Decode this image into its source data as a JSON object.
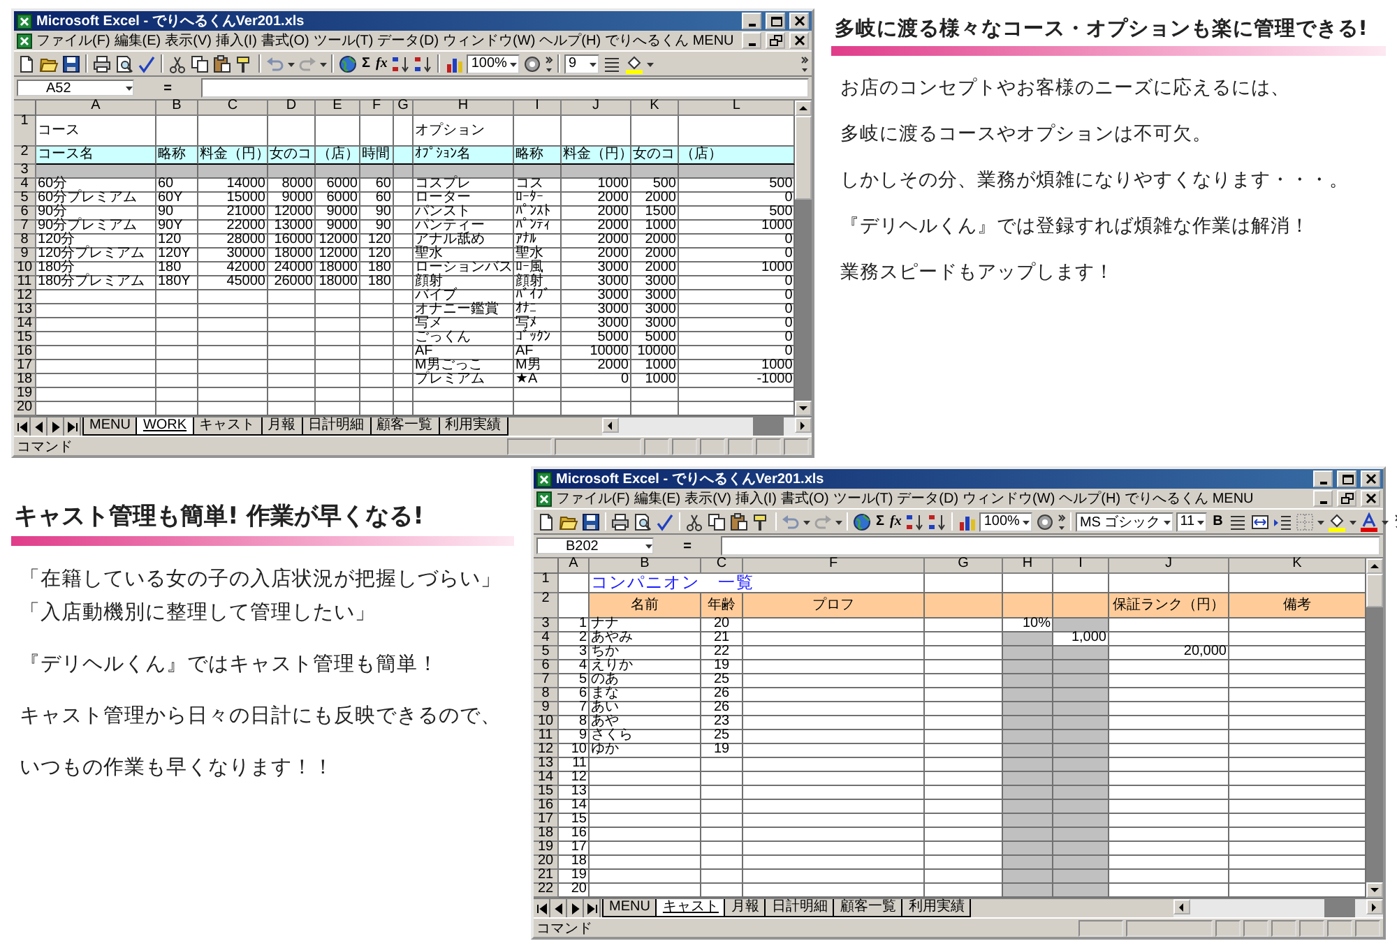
{
  "top": {
    "text": {
      "heading": "多岐に渡る様々なコース・オプションも楽に管理できる!",
      "lines": [
        "お店のコンセプトやお客様のニーズに応えるには、",
        "多岐に渡るコースやオプションは不可欠。",
        "しかしその分、業務が煩雑になりやすくなります・・・。",
        "『デリヘルくん』では登録すれば煩雑な作業は解消！",
        "業務スピードもアップします！"
      ]
    },
    "excel": {
      "kind": "course_sheet",
      "title": "Microsoft Excel - でりへるくんVer201.xls",
      "menu": [
        "ファイル(F)",
        "編集(E)",
        "表示(V)",
        "挿入(I)",
        "書式(O)",
        "ツール(T)",
        "データ(D)",
        "ウィンドウ(W)",
        "ヘルプ(H)",
        "でりへるくん MENU"
      ],
      "toolbar": {
        "sum": "Σ",
        "function": "fx",
        "zoom": "100%",
        "font_size": "9"
      },
      "name_box": "A52",
      "formula_sign": "=",
      "columns": [
        "A",
        "B",
        "C",
        "D",
        "E",
        "F",
        "G",
        "H",
        "I",
        "J",
        "K",
        "L"
      ],
      "row_numbers": [
        "1",
        "2",
        "3",
        "4",
        "5",
        "6",
        "7",
        "8",
        "9",
        "10",
        "11",
        "12",
        "13",
        "14",
        "15",
        "16",
        "17",
        "18",
        "19",
        "20"
      ],
      "course": {
        "title": "コース",
        "headers": [
          "コース名",
          "略称",
          "料金（円）",
          "女のコ",
          "（店）",
          "時間"
        ],
        "rows": [
          [
            "60分",
            "60",
            "14000",
            "8000",
            "6000",
            "60"
          ],
          [
            "60分プレミアム",
            "60Y",
            "15000",
            "9000",
            "6000",
            "60"
          ],
          [
            "90分",
            "90",
            "21000",
            "12000",
            "9000",
            "90"
          ],
          [
            "90分プレミアム",
            "90Y",
            "22000",
            "13000",
            "9000",
            "90"
          ],
          [
            "120分",
            "120",
            "28000",
            "16000",
            "12000",
            "120"
          ],
          [
            "120分プレミアム",
            "120Y",
            "30000",
            "18000",
            "12000",
            "120"
          ],
          [
            "180分",
            "180",
            "42000",
            "24000",
            "18000",
            "180"
          ],
          [
            "180分プレミアム",
            "180Y",
            "45000",
            "26000",
            "18000",
            "180"
          ]
        ]
      },
      "options": {
        "title": "オプション",
        "headers": [
          "ｵﾌﾟｼｮﾝ名",
          "略称",
          "料金（円）",
          "女のコ",
          "（店）"
        ],
        "rows": [
          [
            "コスプレ",
            "コス",
            "1000",
            "500",
            "500"
          ],
          [
            "ローター",
            "ﾛｰﾀｰ",
            "2000",
            "2000",
            "0"
          ],
          [
            "パンスト",
            "ﾊﾟﾝｽﾄ",
            "2000",
            "1500",
            "500"
          ],
          [
            "パンティー",
            "ﾊﾟﾝﾃｨ",
            "2000",
            "1000",
            "1000"
          ],
          [
            "アナル舐め",
            "ｱﾅﾙ",
            "2000",
            "2000",
            "0"
          ],
          [
            "聖水",
            "聖水",
            "2000",
            "2000",
            "0"
          ],
          [
            "ローションバス",
            "ﾛｰ風",
            "3000",
            "2000",
            "1000"
          ],
          [
            "顔射",
            "顔射",
            "3000",
            "3000",
            "0"
          ],
          [
            "バイブ",
            "ﾊﾞｲﾌﾞ",
            "3000",
            "3000",
            "0"
          ],
          [
            "オナニー鑑賞",
            "ｵﾅﾆ",
            "3000",
            "3000",
            "0"
          ],
          [
            "写メ",
            "写ﾒ",
            "3000",
            "3000",
            "0"
          ],
          [
            "ごっくん",
            "ｺﾞｯｸﾝ",
            "5000",
            "5000",
            "0"
          ],
          [
            "AF",
            "AF",
            "10000",
            "10000",
            "0"
          ],
          [
            "M男ごっこ",
            "M男",
            "2000",
            "1000",
            "1000"
          ],
          [
            "プレミアム",
            "★A",
            "0",
            "1000",
            "-1000"
          ]
        ]
      },
      "sheet_tabs": [
        {
          "label": "MENU",
          "selected": false
        },
        {
          "label": "WORK",
          "selected": true
        },
        {
          "label": "キャスト",
          "selected": false
        },
        {
          "label": "月報",
          "selected": false
        },
        {
          "label": "日計明細",
          "selected": false
        },
        {
          "label": "顧客一覧",
          "selected": false
        },
        {
          "label": "利用実績",
          "selected": false
        }
      ],
      "status": "コマンド"
    }
  },
  "bottom": {
    "text": {
      "heading": "キャスト管理も簡単! 作業が早くなる!",
      "lines": [
        "「在籍している女の子の入店状況が把握しづらい」",
        "「入店動機別に整理して管理したい」",
        "『デリヘルくん』ではキャスト管理も簡単！",
        "キャスト管理から日々の日計にも反映できるので、",
        "いつもの作業も早くなります！！"
      ]
    },
    "excel": {
      "kind": "cast_sheet",
      "title": "Microsoft Excel - でりへるくんVer201.xls",
      "menu": [
        "ファイル(F)",
        "編集(E)",
        "表示(V)",
        "挿入(I)",
        "書式(O)",
        "ツール(T)",
        "データ(D)",
        "ウィンドウ(W)",
        "ヘルプ(H)",
        "でりへるくん MENU"
      ],
      "toolbar": {
        "sum": "Σ",
        "function": "fx",
        "zoom": "100%",
        "font": "MS ゴシック",
        "font_size": "11",
        "bold": "B"
      },
      "name_box": "B202",
      "formula_sign": "=",
      "columns": [
        "A",
        "B",
        "C",
        "F",
        "G",
        "H",
        "I",
        "J",
        "K"
      ],
      "row_numbers": [
        "1",
        "2",
        "3",
        "4",
        "5",
        "6",
        "7",
        "8",
        "9",
        "10",
        "11",
        "12",
        "13",
        "14",
        "15",
        "16",
        "17",
        "18",
        "19",
        "20",
        "21",
        "22"
      ],
      "sheet_title": "コンパニオン　一覧",
      "headers": {
        "B": "名前",
        "C": "年齢",
        "F": "プロフ",
        "J": "保証ランク（円）",
        "K": "備考"
      },
      "rows": [
        {
          "A": "1",
          "B": "ナナ",
          "C": "20",
          "H": "10%"
        },
        {
          "A": "2",
          "B": "あやみ",
          "C": "21",
          "I": "1,000"
        },
        {
          "A": "3",
          "B": "ちか",
          "C": "22",
          "J": "20,000"
        },
        {
          "A": "4",
          "B": "えりか",
          "C": "19"
        },
        {
          "A": "5",
          "B": "のあ",
          "C": "25"
        },
        {
          "A": "6",
          "B": "まな",
          "C": "26"
        },
        {
          "A": "7",
          "B": "あい",
          "C": "26"
        },
        {
          "A": "8",
          "B": "あや",
          "C": "23"
        },
        {
          "A": "9",
          "B": "さくら",
          "C": "25"
        },
        {
          "A": "10",
          "B": "ゆか",
          "C": "19"
        },
        {
          "A": "11"
        },
        {
          "A": "12"
        },
        {
          "A": "13"
        },
        {
          "A": "14"
        },
        {
          "A": "15"
        },
        {
          "A": "16"
        },
        {
          "A": "17"
        },
        {
          "A": "18"
        },
        {
          "A": "19"
        },
        {
          "A": "20"
        }
      ],
      "sheet_tabs": [
        {
          "label": "MENU",
          "selected": false
        },
        {
          "label": "キャスト",
          "selected": true
        },
        {
          "label": "月報",
          "selected": false
        },
        {
          "label": "日計明細",
          "selected": false
        },
        {
          "label": "顧客一覧",
          "selected": false
        },
        {
          "label": "利用実績",
          "selected": false
        }
      ],
      "status": "コマンド"
    }
  }
}
